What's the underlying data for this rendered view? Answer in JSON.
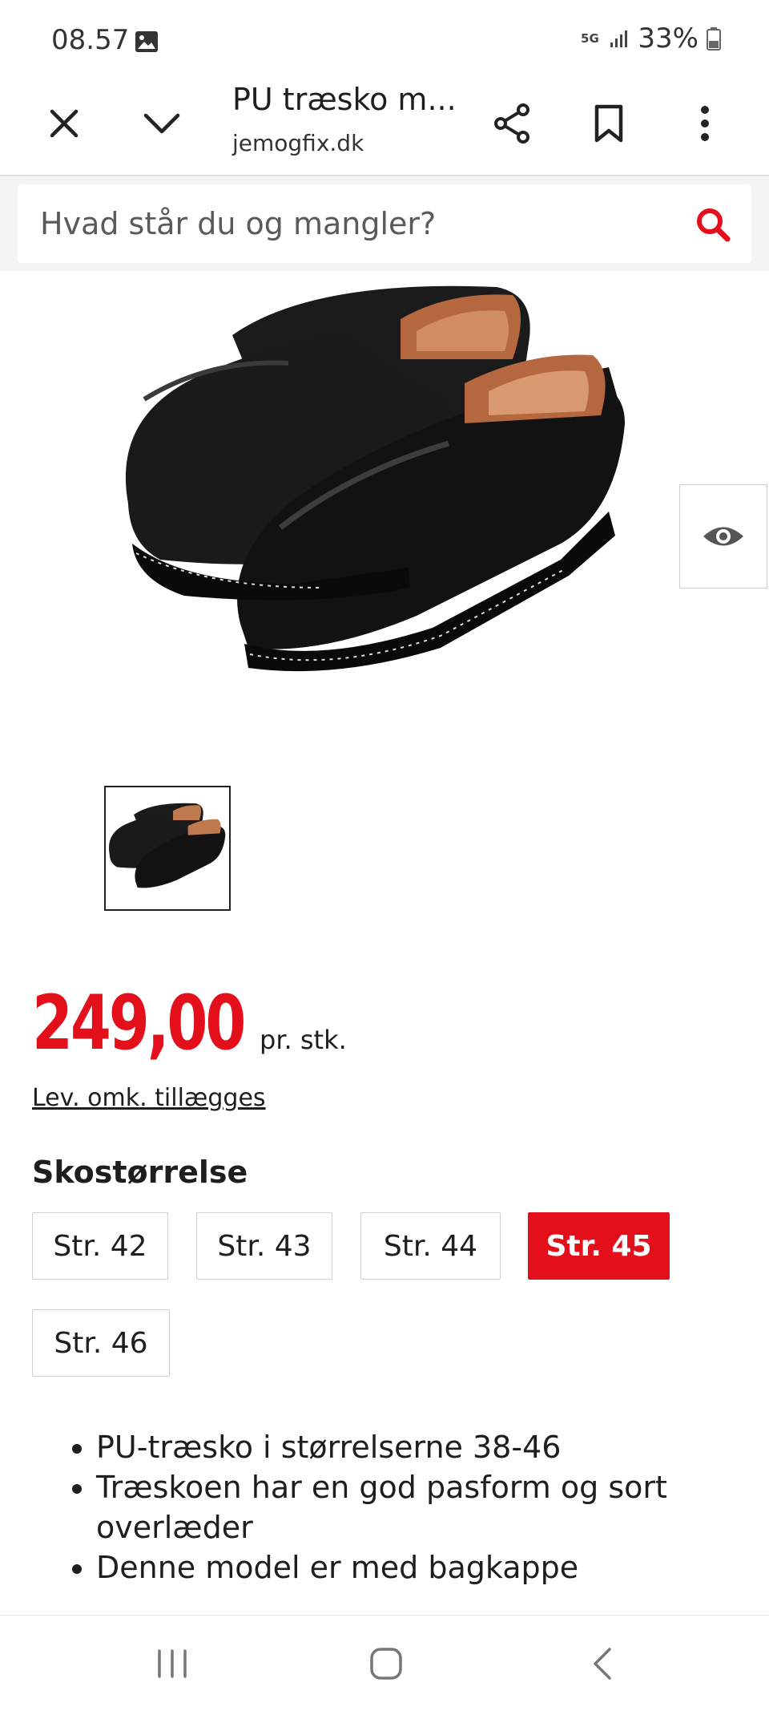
{
  "status_bar": {
    "time": "08.57",
    "network": "5G",
    "battery": "33%"
  },
  "toolbar": {
    "title": "PU træsko m...",
    "domain": "jemogfix.dk"
  },
  "search": {
    "placeholder": "Hvad står du og mangler?"
  },
  "product": {
    "price": "249,00",
    "price_unit": "pr. stk.",
    "shipping_note": "Lev. omk. tillægges",
    "size_heading": "Skostørrelse",
    "sizes": [
      "Str. 42",
      "Str. 43",
      "Str. 44",
      "Str. 45",
      "Str. 46"
    ],
    "selected_size": "Str. 45",
    "features": [
      "PU-træsko i størrelserne 38-46",
      "Træskoen har en god pasform og sort overlæder",
      "Denne model er med bagkappe"
    ]
  },
  "colors": {
    "accent_red": "#e3101c",
    "text": "#1e1e1e"
  },
  "icons": [
    "image-icon",
    "signal-icon",
    "battery-icon",
    "close-icon",
    "chevron-down-icon",
    "share-icon",
    "bookmark-icon",
    "more-vert-icon",
    "search-icon",
    "eye-icon",
    "recent-apps-icon",
    "home-icon",
    "back-icon"
  ]
}
